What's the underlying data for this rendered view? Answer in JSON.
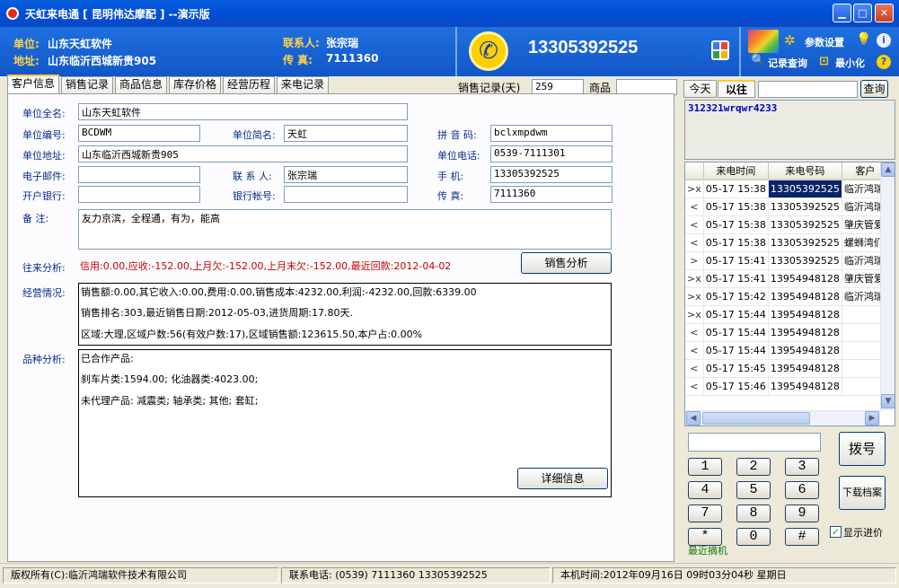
{
  "window": {
    "title": "天虹来电通 [ 昆明伟达摩配 ] --演示版"
  },
  "header": {
    "company_label": "单位:",
    "company_value": "山东天虹软件",
    "address_label": "地址:",
    "address_value": "山东临沂西城新贵905",
    "contact_label": "联系人:",
    "contact_value": "张宗瑞",
    "fax_label": "传  真:",
    "fax_value": "7111360",
    "phone_number": "13305392525",
    "settings_label": "参数设置",
    "records_label": "记录查询",
    "minimize_label": "最小化"
  },
  "tabs": [
    "客户信息",
    "销售记录",
    "商品信息",
    "库存价格",
    "经营历程",
    "来电记录"
  ],
  "filters": {
    "sales_days_label": "销售记录(天)",
    "sales_days_value": "259",
    "product_label": "商品",
    "product_value": ""
  },
  "form": {
    "full_name_label": "单位全名:",
    "full_name": "山东天虹软件",
    "code_label": "单位编号:",
    "code": "BCDWM",
    "short_name_label": "单位简名:",
    "short_name": "天虹",
    "pinyin_label": "拼 音 码:",
    "pinyin": "bclxmpdwm",
    "address_label": "单位地址:",
    "address": "山东临沂西城新贵905",
    "unit_phone_label": "单位电话:",
    "unit_phone": "0539-7111301",
    "email_label": "电子邮件:",
    "email": "",
    "contact_label": "联 系 人:",
    "contact": "张宗瑞",
    "mobile_label": "手    机:",
    "mobile": "13305392525",
    "bank_label": "开户银行:",
    "bank": "",
    "account_label": "银行帐号:",
    "account": "",
    "fax_label": "传    真:",
    "fax": "7111360",
    "remark_label": "备    注:",
    "remark": "友力京滨，全程通，有为，能高"
  },
  "analysis": {
    "trade_label": "往来分析:",
    "trade_text": "信用:0.00,应收:-152.00,上月欠:-152.00,上月末欠:-152.00,最近回款:2012-04-02",
    "sales_analysis_button": "销售分析",
    "ops_label": "经营情况:",
    "ops_lines": [
      "销售额:0.00,其它收入:0.00,费用:0.00,销售成本:4232.00,利润:-4232.00,回款:6339.00",
      "销售排名:303,最近销售日期:2012-05-03,进货周期:17.80天.",
      "区域:大理,区域户数:56(有效户数:17),区域销售额:123615.50,本户占:0.00%"
    ],
    "variety_label": "品种分析:",
    "variety_lines": [
      "已合作产品:",
      "刹车片类:1594.00;   化油器类:4023.00;",
      "未代理产品:   减震类;      轴承类;      其他;      套缸;"
    ],
    "detail_button": "详细信息"
  },
  "right": {
    "tab_today": "今天",
    "tab_past": "以往",
    "search_value": "",
    "search_button": "查询",
    "memo": "312321wrqwr4233",
    "columns": [
      "",
      "来电时间",
      "来电号码",
      "客户"
    ],
    "calls": [
      {
        "dir": ">x",
        "time": "05-17 15:38",
        "number": "13305392525",
        "customer": "临沂鸿瑞"
      },
      {
        "dir": "<",
        "time": "05-17 15:38",
        "number": "13305392525",
        "customer": "临沂鸿瑞"
      },
      {
        "dir": "<",
        "time": "05-17 15:38",
        "number": "13305392525",
        "customer": "肇庆管爱"
      },
      {
        "dir": "<",
        "time": "05-17 15:38",
        "number": "13305392525",
        "customer": "螺蛳湾们"
      },
      {
        "dir": ">",
        "time": "05-17 15:41",
        "number": "13305392525",
        "customer": "临沂鸿瑞"
      },
      {
        "dir": ">x",
        "time": "05-17 15:41",
        "number": "13954948128",
        "customer": "肇庆管爱"
      },
      {
        "dir": ">x",
        "time": "05-17 15:42",
        "number": "13954948128",
        "customer": "临沂鸿瑞"
      },
      {
        "dir": ">x",
        "time": "05-17 15:44",
        "number": "13954948128",
        "customer": ""
      },
      {
        "dir": "<",
        "time": "05-17 15:44",
        "number": "13954948128",
        "customer": ""
      },
      {
        "dir": "<",
        "time": "05-17 15:44",
        "number": "13954948128",
        "customer": ""
      },
      {
        "dir": "<",
        "time": "05-17 15:45",
        "number": "13954948128",
        "customer": ""
      },
      {
        "dir": "<",
        "time": "05-17 15:46",
        "number": "13954948128",
        "customer": ""
      }
    ],
    "dial_value": "",
    "dial_button": "拨号",
    "download_button": "下载档案",
    "show_purchase_label": "显示进价",
    "recent_label": "最近摘机",
    "keys": [
      "1",
      "2",
      "3",
      "4",
      "5",
      "6",
      "7",
      "8",
      "9",
      "*",
      "0",
      "#"
    ]
  },
  "status": {
    "copyright": "版权所有(C):临沂鸿瑞软件技术有限公司",
    "contact_phone": "联系电话: (0539) 7111360 13305392525",
    "local_time": "本机时间:2012年09月16日 09时03分04秒 星期日"
  }
}
